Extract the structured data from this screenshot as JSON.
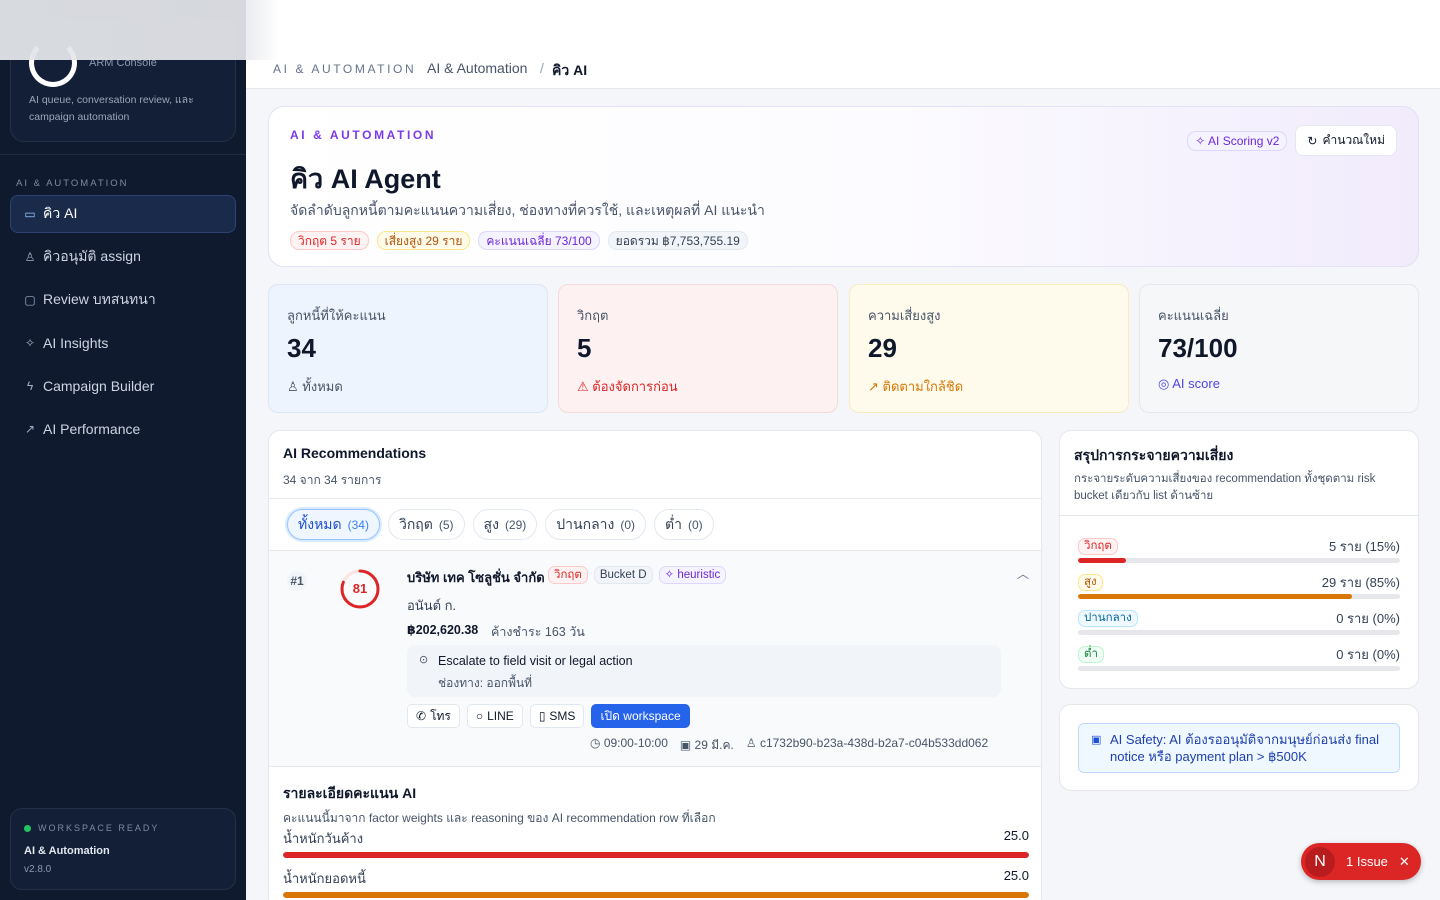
{
  "sidebar": {
    "brand_sub": "ARM Console",
    "brand_desc": "AI queue, conversation review, และ campaign automation",
    "section_label": "AI & AUTOMATION",
    "items": [
      {
        "label": "คิว AI",
        "icon": "ticket-icon"
      },
      {
        "label": "คิวอนุมัติ assign",
        "icon": "user-check-icon"
      },
      {
        "label": "Review บทสนทนา",
        "icon": "message-icon"
      },
      {
        "label": "AI Insights",
        "icon": "sparkles-icon"
      },
      {
        "label": "Campaign Builder",
        "icon": "bolt-icon"
      },
      {
        "label": "AI Performance",
        "icon": "trend-icon"
      }
    ],
    "workspace": {
      "status": "WORKSPACE READY",
      "name": "AI & Automation",
      "version": "v2.8.0"
    }
  },
  "breadcrumb": {
    "section": "AI & AUTOMATION",
    "parent": "AI & Automation",
    "separator": "/",
    "current": "คิว AI"
  },
  "hero": {
    "kicker": "AI & AUTOMATION",
    "title": "คิว AI Agent",
    "subtitle": "จัดลำดับลูกหนี้ตามคะแนนความเสี่ยง, ช่องทางที่ควรใช้, และเหตุผลที่ AI แนะนำ",
    "badges": [
      "วิกฤต 5 ราย",
      "เสี่ยงสูง 29 ราย",
      "คะแนนเฉลี่ย 73/100",
      "ยอดรวม ฿7,753,755.19"
    ],
    "scoring_badge": "AI Scoring v2",
    "recalc_label": "คำนวณใหม่"
  },
  "stats": [
    {
      "label": "ลูกหนี้ที่ให้คะแนน",
      "value": "34",
      "note": "ทั้งหมด"
    },
    {
      "label": "วิกฤต",
      "value": "5",
      "note": "ต้องจัดการก่อน"
    },
    {
      "label": "ความเสี่ยงสูง",
      "value": "29",
      "note": "ติดตามใกล้ชิด"
    },
    {
      "label": "คะแนนเฉลี่ย",
      "value": "73/100",
      "note": "AI score"
    }
  ],
  "recommendations": {
    "title": "AI Recommendations",
    "count": "34 จาก 34 รายการ",
    "tabs": [
      {
        "label": "ทั้งหมด",
        "count": "(34)"
      },
      {
        "label": "วิกฤต",
        "count": "(5)"
      },
      {
        "label": "สูง",
        "count": "(29)"
      },
      {
        "label": "ปานกลาง",
        "count": "(0)"
      },
      {
        "label": "ต่ำ",
        "count": "(0)"
      }
    ],
    "row": {
      "rank": "#1",
      "score": "81",
      "score_value": 81,
      "company": "บริษัท เทค โซลูชั่น จำกัด",
      "risk_badge": "วิกฤต",
      "bucket": "Bucket D",
      "method": "heuristic",
      "contact": "อนันต์ ก.",
      "amount": "฿202,620.38",
      "overdue": "ค้างชำระ 163 วัน",
      "reason": "Escalate to field visit or legal action",
      "channel": "ช่องทาง: ออกพื้นที่",
      "actions": [
        "โทร",
        "LINE",
        "SMS",
        "เปิด workspace"
      ],
      "time": "09:00-10:00",
      "date": "29 มี.ค.",
      "assignee": "c1732b90-b23a-438d-b2a7-c04b533dd062"
    },
    "score_detail": {
      "title": "รายละเอียดคะแนน AI",
      "subtitle": "คะแนนนี้มาจาก factor weights และ reasoning ของ AI recommendation row ที่เลือก",
      "factors": [
        {
          "label": "น้ำหนักวันค้าง",
          "value": "25.0",
          "fraction": 1.0,
          "color": "#dc2626"
        },
        {
          "label": "น้ำหนักยอดหนี้",
          "value": "25.0",
          "fraction": 1.0,
          "color": "#d97706"
        }
      ]
    }
  },
  "risk_distribution": {
    "title": "สรุปการกระจายความเสี่ยง",
    "subtitle": "กระจายระดับความเสี่ยงของ recommendation ทั้งชุดตาม risk bucket เดียวกับ list ด้านซ้าย",
    "buckets": [
      {
        "label": "วิกฤต",
        "value": "5 ราย (15%)",
        "fraction": 0.15,
        "color": "#dc2626"
      },
      {
        "label": "สูง",
        "value": "29 ราย (85%)",
        "fraction": 0.85,
        "color": "#d97706"
      },
      {
        "label": "ปานกลาง",
        "value": "0 ราย (0%)",
        "fraction": 0,
        "color": "#0ea5e9"
      },
      {
        "label": "ต่ำ",
        "value": "0 ราย (0%)",
        "fraction": 0,
        "color": "#16a34a"
      }
    ]
  },
  "safety": {
    "text": "AI Safety: AI ต้องรออนุมัติจากมนุษย์ก่อนส่ง final notice หรือ payment plan > ฿500K"
  },
  "issue_badge": {
    "logo": "N",
    "label": "1 Issue",
    "close": "✕"
  }
}
